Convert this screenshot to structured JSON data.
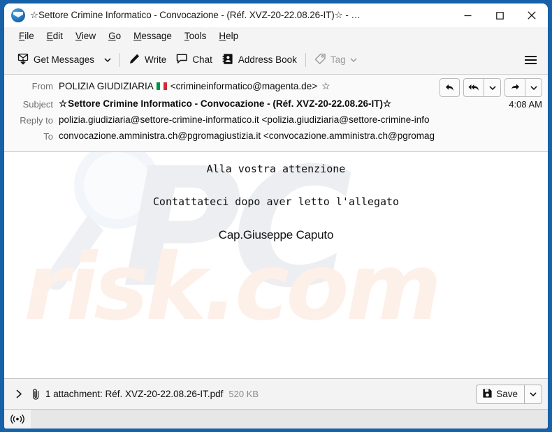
{
  "window": {
    "title": "☆Settore Crimine Informatico - Convocazione - (Réf. XVZ-20-22.08.26-IT)☆ - …",
    "app_icon": "thunderbird-icon",
    "controls": {
      "minimize": "minimize-icon",
      "maximize": "maximize-icon",
      "close": "close-icon"
    }
  },
  "menubar": {
    "items": [
      {
        "accesskey": "F",
        "rest": "ile"
      },
      {
        "accesskey": "E",
        "rest": "dit"
      },
      {
        "accesskey": "V",
        "rest": "iew"
      },
      {
        "accesskey": "G",
        "rest": "o"
      },
      {
        "accesskey": "M",
        "rest": "essage"
      },
      {
        "accesskey": "T",
        "rest": "ools"
      },
      {
        "accesskey": "H",
        "rest": "elp"
      }
    ]
  },
  "toolbar": {
    "get_messages": "Get Messages",
    "write": "Write",
    "chat": "Chat",
    "address_book": "Address Book",
    "tag": "Tag",
    "menu": "app-menu"
  },
  "header": {
    "labels": {
      "from": "From",
      "subject": "Subject",
      "reply_to": "Reply to",
      "to": "To"
    },
    "from_name": "POLIZIA GIUDIZIARIA",
    "from_flag": "🇮🇹",
    "from_address": "<crimineinformatico@magenta.de>",
    "from_star": "☆",
    "subject_star": "☆",
    "subject": "Settore Crimine Informatico - Convocazione - (Réf. XVZ-20-22.08.26-IT)",
    "subject_star_end": "☆",
    "reply_to": "polizia.giudiziaria@settore-crimine-informatico.it <polizia.giudiziaria@settore-crimine-info",
    "to": "convocazione.amministra.ch@pgromagiustizia.it <convocazione.amministra.ch@pgromag",
    "time": "4:08 AM",
    "actions": {
      "reply": "reply-icon",
      "reply_all": "reply-all-icon",
      "reply_all_more": "chevron-down-icon",
      "forward": "forward-icon",
      "forward_more": "chevron-down-icon"
    }
  },
  "body": {
    "line1": "Alla vostra attenzione",
    "line2": "Contattateci dopo aver letto l'allegato",
    "signature": "Cap.Giuseppe Caputo",
    "watermark_text": "PCrisk.com",
    "watermark_pc": "PC",
    "watermark_risk": "risk.com"
  },
  "attachment": {
    "expander": "chevron-right-icon",
    "clip": "paperclip-icon",
    "text": "1 attachment: Réf. XVZ-20-22.08.26-IT.pdf",
    "size": "520 KB",
    "save_label": "Save",
    "save_caret": "chevron-down-icon"
  },
  "statusbar": {
    "online_indicator": "online-icon"
  },
  "colors": {
    "window_border": "#1661a8",
    "toolbar_bg": "#f4f4f4",
    "header_bg": "#fafafa",
    "label_grey": "#6e6e6e",
    "watermark_grey": "#eceef2",
    "watermark_orange": "#fdf0e9",
    "flag_green": "#009246",
    "flag_red": "#ce2b37"
  }
}
